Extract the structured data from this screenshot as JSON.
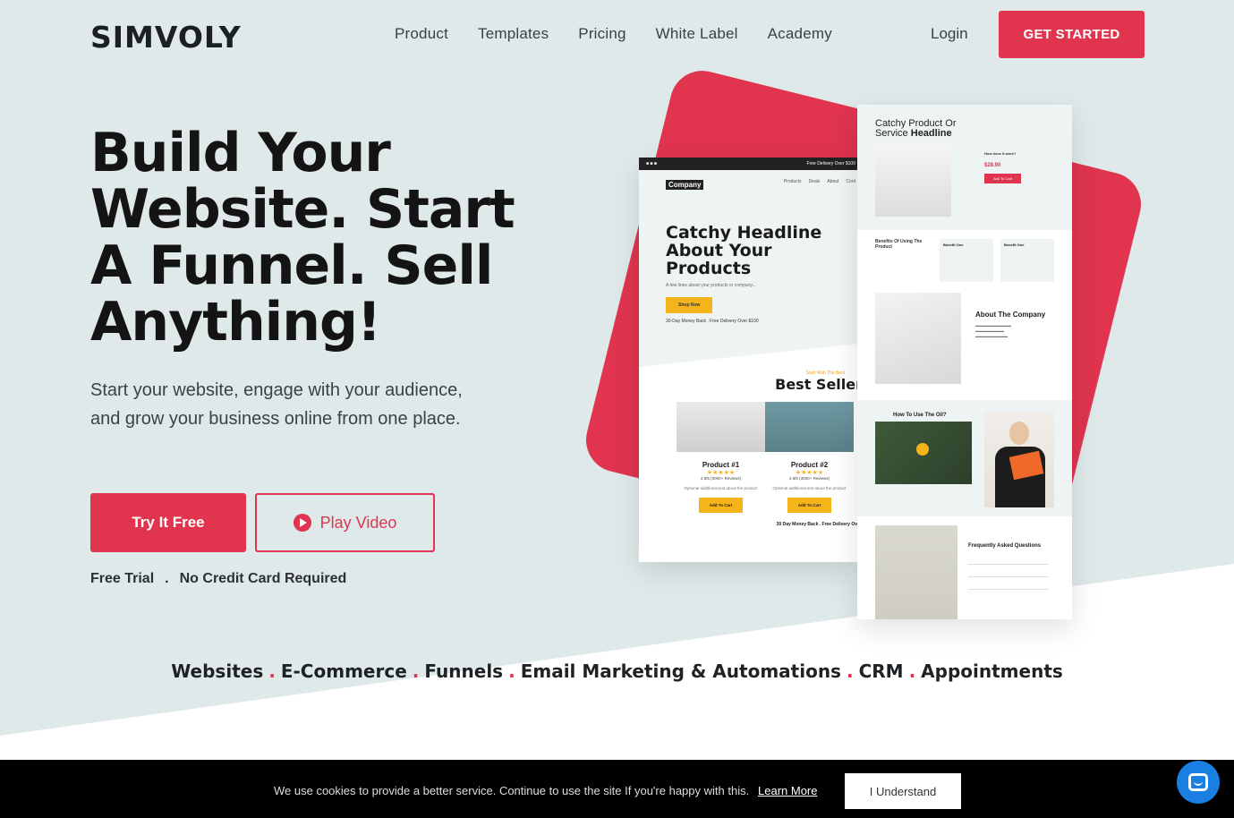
{
  "header": {
    "logo": "SIMVOLY",
    "nav": [
      "Product",
      "Templates",
      "Pricing",
      "White Label",
      "Academy"
    ],
    "login": "Login",
    "cta": "GET STARTED"
  },
  "hero": {
    "headline": "Build Your Website. Start A Funnel. Sell Anything!",
    "subtitle": "Start your website, engage with your audience, and grow your business online from one place.",
    "try_button": "Try It Free",
    "play_button": "Play Video",
    "note_1": "Free Trial",
    "note_sep": ".",
    "note_2": "No Credit Card Required"
  },
  "mockup_left": {
    "delivery_strip": "Free Delivery Over $100",
    "company": "Company",
    "nav": [
      "Products",
      "Deals",
      "About",
      "Cont"
    ],
    "headline": "Catchy Headline About Your Products",
    "small": "A few lines about your products or company...",
    "shop": "Shop Now",
    "delivery": "30-Day Money Back . Free Delivery Over $100",
    "best_small": "Start With The Best",
    "best": "Best Seller",
    "products": [
      {
        "name": "Product #1",
        "rating": "4.8/5 (3000+ Reviews)",
        "desc": "Optional additional text about the product",
        "add": "Add To Cart"
      },
      {
        "name": "Product #2",
        "rating": "4.8/5 (3000+ Reviews)",
        "desc": "Optional additional text about the product",
        "add": "Add To Cart"
      }
    ],
    "footer": "30 Day Money Back . Free Delivery Ov"
  },
  "mockup_right": {
    "title_1": "Catchy Product Or",
    "title_2": "Service",
    "title_bold": "Headline",
    "how": "How does it work?",
    "price": "$28.90",
    "add": "Add To Cart",
    "benefits": "Benefits Of Using The Product",
    "benefit_one": "Benefit One",
    "benefit_two": "Benefit One",
    "about": "About The Company",
    "how_to": "How To Use The Oil?",
    "faq": "Frequently Asked Questions"
  },
  "features": [
    "Websites",
    "E-Commerce",
    "Funnels",
    "Email Marketing & Automations",
    "CRM",
    "Appointments"
  ],
  "feature_sep": ".",
  "cookie": {
    "text": "We use cookies to provide a better service. Continue to use the site If you're happy with this.",
    "link": "Learn More",
    "button": "I Understand"
  },
  "colors": {
    "accent": "#e0344f",
    "mint": "#dfe9e9",
    "chat": "#1a7fe2"
  }
}
